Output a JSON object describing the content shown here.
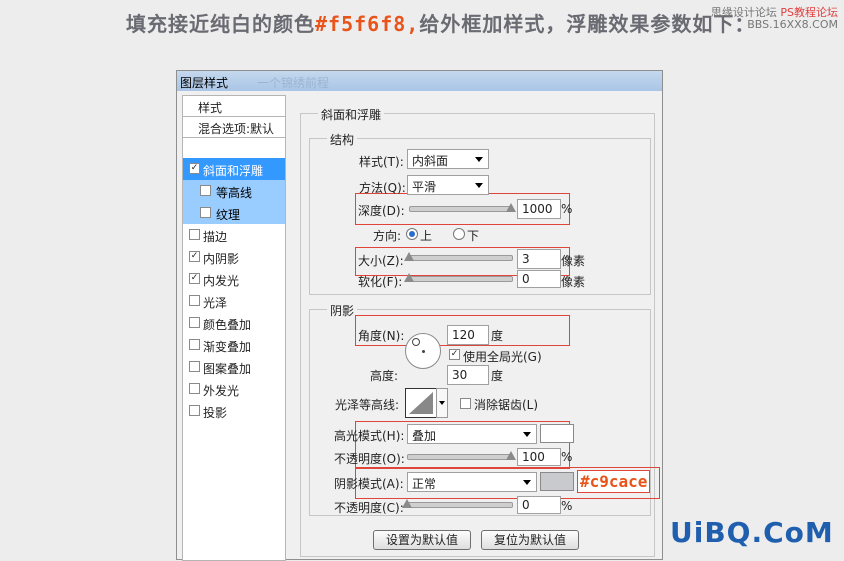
{
  "headline": {
    "prefix": "填充接近纯白的颜色",
    "highlight": "#f5f6f8,",
    "suffix": "给外框加样式，浮雕效果参数如下："
  },
  "watermark_top": {
    "line1": "思缘设计论坛",
    "line2": "PS教程论坛",
    "line3": "BBS.16XX8.COM"
  },
  "watermark_bottom": "UiBQ.CoM",
  "dialog": {
    "title": "图层样式",
    "title_blurred": "一个锦绣前程",
    "left": {
      "header": "样式",
      "blend": "混合选项:默认",
      "items": [
        {
          "label": "斜面和浮雕",
          "checked": true
        },
        {
          "label": "等高线",
          "checked": false
        },
        {
          "label": "纹理",
          "checked": false
        },
        {
          "label": "描边",
          "checked": false
        },
        {
          "label": "内阴影",
          "checked": true
        },
        {
          "label": "内发光",
          "checked": true
        },
        {
          "label": "光泽",
          "checked": false
        },
        {
          "label": "颜色叠加",
          "checked": false
        },
        {
          "label": "渐变叠加",
          "checked": false
        },
        {
          "label": "图案叠加",
          "checked": false
        },
        {
          "label": "外发光",
          "checked": false
        },
        {
          "label": "投影",
          "checked": false
        }
      ]
    },
    "bevel": {
      "group_title": "斜面和浮雕",
      "structure_title": "结构",
      "style_label": "样式(T):",
      "style_value": "内斜面",
      "technique_label": "方法(Q):",
      "technique_value": "平滑",
      "depth_label": "深度(D):",
      "depth_value": "1000",
      "depth_unit": "%",
      "depth_slider": 1.0,
      "direction_label": "方向:",
      "direction_up": "上",
      "direction_down": "下",
      "size_label": "大小(Z):",
      "size_value": "3",
      "size_unit": "像素",
      "size_slider": 0.0,
      "soften_label": "软化(F):",
      "soften_value": "0",
      "soften_unit": "像素",
      "soften_slider": 0.0
    },
    "shading": {
      "title": "阴影",
      "angle_label": "角度(N):",
      "angle_value": "120",
      "angle_unit": "度",
      "global_light_label": "使用全局光(G)",
      "altitude_label": "高度:",
      "altitude_value": "30",
      "altitude_unit": "度",
      "gloss_label": "光泽等高线:",
      "antialias_label": "消除锯齿(L)",
      "highlight_mode_label": "高光模式(H):",
      "highlight_mode_value": "叠加",
      "highlight_opacity_label": "不透明度(O):",
      "highlight_opacity_value": "100",
      "highlight_opacity_unit": "%",
      "highlight_opacity_slider": 1.0,
      "shadow_mode_label": "阴影模式(A):",
      "shadow_mode_value": "正常",
      "shadow_color_annotation": "#c9cace",
      "shadow_opacity_label": "不透明度(C):",
      "shadow_opacity_value": "0",
      "shadow_opacity_unit": "%",
      "shadow_opacity_slider": 0.0
    },
    "buttons": {
      "set_default": "设置为默认值",
      "reset_default": "复位为默认值"
    }
  },
  "colors": {
    "highlight_color": "#ffffff",
    "shadow_color": "#c9cace",
    "selected_item": "#3399ff",
    "sub_item": "#99ccff",
    "annotation_red": "#e0453a",
    "annotation_orange": "#e8541a"
  }
}
